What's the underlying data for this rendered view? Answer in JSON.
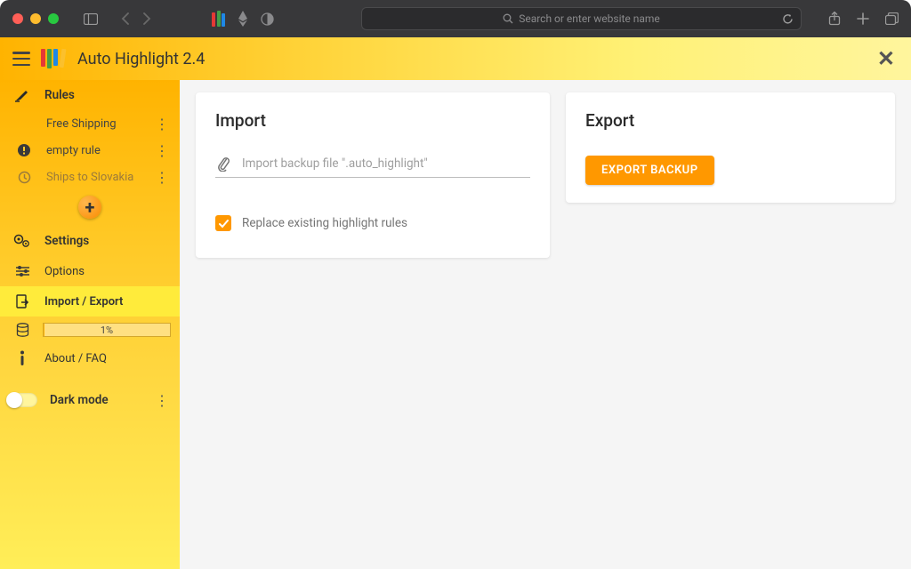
{
  "browser": {
    "address_placeholder": "Search or enter website name"
  },
  "appbar": {
    "title": "Auto Highlight 2.4"
  },
  "sidebar": {
    "rules_label": "Rules",
    "rules": [
      {
        "label": "Free Shipping",
        "muted": false,
        "icon": "none"
      },
      {
        "label": "empty rule",
        "muted": false,
        "icon": "warning"
      },
      {
        "label": "Ships to Slovakia",
        "muted": true,
        "icon": "clock"
      }
    ],
    "settings_label": "Settings",
    "options_label": "Options",
    "import_export_label": "Import / Export",
    "storage_percent": "1%",
    "about_label": "About / FAQ",
    "dark_label": "Dark mode"
  },
  "import": {
    "title": "Import",
    "file_placeholder": "Import backup file \".auto_highlight\"",
    "replace_label": "Replace existing highlight rules",
    "replace_checked": true
  },
  "export": {
    "title": "Export",
    "button_label": "EXPORT BACKUP"
  }
}
